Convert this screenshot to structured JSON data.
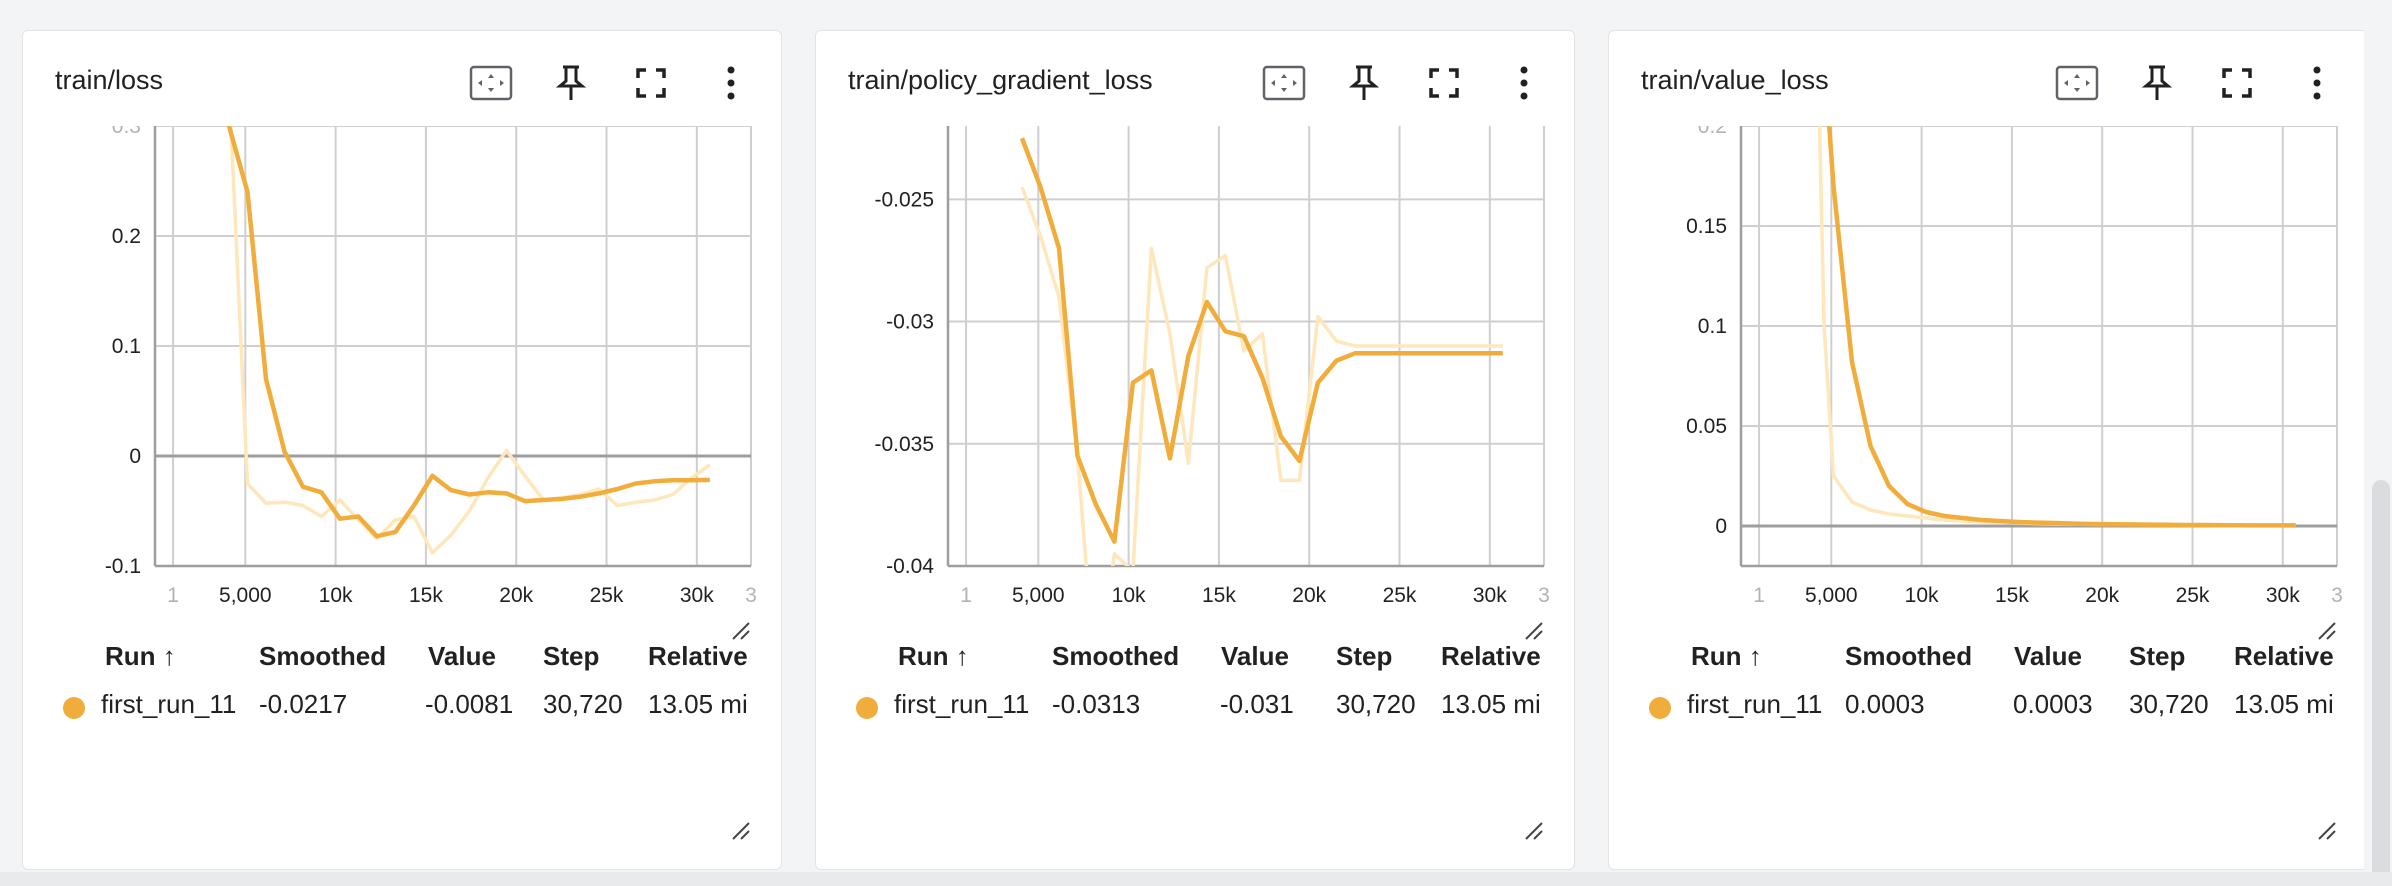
{
  "accent_color": "#f0ad3c",
  "accent_light": "#fde7bb",
  "toolbar_icons": [
    "fit-domain-icon",
    "pin-icon",
    "fullscreen-icon",
    "more-vert-icon"
  ],
  "cards": [
    {
      "title": "train/loss",
      "table": {
        "headers": [
          "Run ↑",
          "Smoothed",
          "Value",
          "Step",
          "Relative"
        ],
        "row": {
          "run": "first_run_11",
          "smoothed": "-0.0217",
          "value": "-0.0081",
          "step": "30,720",
          "relative": "13.05 mi"
        }
      }
    },
    {
      "title": "train/policy_gradient_loss",
      "table": {
        "headers": [
          "Run ↑",
          "Smoothed",
          "Value",
          "Step",
          "Relative"
        ],
        "row": {
          "run": "first_run_11",
          "smoothed": "-0.0313",
          "value": "-0.031",
          "step": "30,720",
          "relative": "13.05 mi"
        }
      }
    },
    {
      "title": "train/value_loss",
      "table": {
        "headers": [
          "Run ↑",
          "Smoothed",
          "Value",
          "Step",
          "Relative"
        ],
        "row": {
          "run": "first_run_11",
          "smoothed": "0.0003",
          "value": "0.0003",
          "step": "30,720",
          "relative": "13.05 mi"
        }
      }
    }
  ],
  "chart_data": [
    {
      "type": "line",
      "title": "train/loss",
      "xlabel": "",
      "ylabel": "",
      "xlim": [
        0,
        33000
      ],
      "ylim": [
        -0.1,
        0.3
      ],
      "xticks": [
        1000,
        5000,
        10000,
        15000,
        20000,
        25000,
        30000,
        33000
      ],
      "xtick_labels": [
        "1",
        "5,000",
        "10k",
        "15k",
        "20k",
        "25k",
        "30k",
        "3"
      ],
      "yticks": [
        -0.1,
        0,
        0.1,
        0.2,
        0.3
      ],
      "ytick_labels": [
        "-0.1",
        "0",
        "0.1",
        "0.2",
        "0.3"
      ],
      "grid": true,
      "series": [
        {
          "name": "first_run_11",
          "role": "raw",
          "x": [
            4096,
            4200,
            5120,
            6144,
            7168,
            8192,
            9216,
            10240,
            11264,
            12288,
            13312,
            14336,
            15360,
            16384,
            17408,
            18432,
            19456,
            20480,
            21504,
            22528,
            23552,
            24576,
            25600,
            26624,
            27648,
            28672,
            29696,
            30720
          ],
          "y": [
            0.5,
            0.3,
            -0.025,
            -0.043,
            -0.042,
            -0.045,
            -0.055,
            -0.04,
            -0.058,
            -0.075,
            -0.058,
            -0.055,
            -0.088,
            -0.072,
            -0.05,
            -0.02,
            0.005,
            -0.018,
            -0.04,
            -0.038,
            -0.035,
            -0.03,
            -0.045,
            -0.042,
            -0.04,
            -0.035,
            -0.02,
            -0.0081
          ]
        },
        {
          "name": "first_run_11",
          "role": "smoothed",
          "x": [
            4096,
            5120,
            6144,
            7168,
            8192,
            9216,
            10240,
            11264,
            12288,
            13312,
            14336,
            15360,
            16384,
            17408,
            18432,
            19456,
            20480,
            21504,
            22528,
            23552,
            24576,
            25600,
            26624,
            27648,
            28672,
            29696,
            30720
          ],
          "y": [
            0.3,
            0.24,
            0.07,
            0.004,
            -0.028,
            -0.033,
            -0.057,
            -0.055,
            -0.073,
            -0.069,
            -0.045,
            -0.018,
            -0.031,
            -0.035,
            -0.033,
            -0.034,
            -0.041,
            -0.04,
            -0.039,
            -0.037,
            -0.034,
            -0.03,
            -0.025,
            -0.023,
            -0.022,
            -0.022,
            -0.0217
          ]
        }
      ]
    },
    {
      "type": "line",
      "title": "train/policy_gradient_loss",
      "xlabel": "",
      "ylabel": "",
      "xlim": [
        0,
        33000
      ],
      "ylim": [
        -0.04,
        -0.022
      ],
      "xticks": [
        1000,
        5000,
        10000,
        15000,
        20000,
        25000,
        30000,
        33000
      ],
      "xtick_labels": [
        "1",
        "5,000",
        "10k",
        "15k",
        "20k",
        "25k",
        "30k",
        "3"
      ],
      "yticks": [
        -0.04,
        -0.035,
        -0.03,
        -0.025
      ],
      "ytick_labels": [
        "-0.04",
        "-0.035",
        "-0.03",
        "-0.025"
      ],
      "grid": true,
      "series": [
        {
          "name": "first_run_11",
          "role": "raw",
          "x": [
            4096,
            5120,
            6144,
            7168,
            8192,
            9216,
            10240,
            11264,
            12288,
            13312,
            14336,
            15360,
            16384,
            17408,
            18432,
            19456,
            20480,
            21504,
            22528,
            23552,
            24576,
            25600,
            26624,
            27648,
            28672,
            29696,
            30720
          ],
          "y": [
            -0.0245,
            -0.0265,
            -0.029,
            -0.0355,
            -0.045,
            -0.0395,
            -0.0402,
            -0.027,
            -0.0305,
            -0.0358,
            -0.0278,
            -0.0273,
            -0.0312,
            -0.0305,
            -0.0365,
            -0.0365,
            -0.0298,
            -0.0308,
            -0.031,
            -0.031,
            -0.031,
            -0.031,
            -0.031,
            -0.031,
            -0.031,
            -0.031,
            -0.031
          ]
        },
        {
          "name": "first_run_11",
          "role": "smoothed",
          "x": [
            4096,
            5120,
            6144,
            7168,
            8192,
            9216,
            10240,
            11264,
            12288,
            13312,
            14336,
            15360,
            16384,
            17408,
            18432,
            19456,
            20480,
            21504,
            22528,
            23552,
            24576,
            25600,
            26624,
            27648,
            28672,
            29696,
            30720
          ],
          "y": [
            -0.0225,
            -0.0245,
            -0.027,
            -0.0355,
            -0.0375,
            -0.039,
            -0.0325,
            -0.032,
            -0.0356,
            -0.0314,
            -0.0292,
            -0.0304,
            -0.0306,
            -0.0323,
            -0.0347,
            -0.0357,
            -0.0325,
            -0.0316,
            -0.0313,
            -0.0313,
            -0.0313,
            -0.0313,
            -0.0313,
            -0.0313,
            -0.0313,
            -0.0313,
            -0.0313
          ]
        }
      ]
    },
    {
      "type": "line",
      "title": "train/value_loss",
      "xlabel": "",
      "ylabel": "",
      "xlim": [
        0,
        33000
      ],
      "ylim": [
        -0.02,
        0.2
      ],
      "xticks": [
        1000,
        5000,
        10000,
        15000,
        20000,
        25000,
        30000,
        33000
      ],
      "xtick_labels": [
        "1",
        "5,000",
        "10k",
        "15k",
        "20k",
        "25k",
        "30k",
        "3"
      ],
      "yticks": [
        0,
        0.05,
        0.1,
        0.15,
        0.2
      ],
      "ytick_labels": [
        "0",
        "0.05",
        "0.1",
        "0.15",
        "0.2"
      ],
      "grid": true,
      "series": [
        {
          "name": "first_run_11",
          "role": "raw",
          "x": [
            4096,
            4600,
            5120,
            6144,
            7168,
            8192,
            9216,
            10240,
            11264,
            12288,
            13312,
            14336,
            15360,
            16384,
            17408,
            18432,
            19456,
            20480,
            21504,
            22528,
            23552,
            24576,
            25600,
            26624,
            27648,
            28672,
            29696,
            30720
          ],
          "y": [
            0.3,
            0.1,
            0.025,
            0.012,
            0.008,
            0.006,
            0.005,
            0.004,
            0.003,
            0.0025,
            0.002,
            0.0018,
            0.0015,
            0.0012,
            0.001,
            0.0009,
            0.0008,
            0.0007,
            0.0006,
            0.0006,
            0.0005,
            0.0005,
            0.0004,
            0.0004,
            0.0004,
            0.0003,
            0.0003,
            0.0003
          ]
        },
        {
          "name": "first_run_11",
          "role": "smoothed",
          "x": [
            4096,
            5120,
            6144,
            7168,
            8192,
            9216,
            10240,
            11264,
            12288,
            13312,
            14336,
            15360,
            16384,
            17408,
            18432,
            19456,
            20480,
            21504,
            22528,
            23552,
            24576,
            25600,
            26624,
            27648,
            28672,
            29696,
            30720
          ],
          "y": [
            0.3,
            0.17,
            0.082,
            0.04,
            0.02,
            0.011,
            0.007,
            0.005,
            0.004,
            0.003,
            0.0025,
            0.002,
            0.0017,
            0.0015,
            0.0012,
            0.001,
            0.0009,
            0.0008,
            0.0007,
            0.0006,
            0.0005,
            0.0005,
            0.0004,
            0.0004,
            0.0003,
            0.0003,
            0.0003
          ]
        }
      ]
    }
  ]
}
